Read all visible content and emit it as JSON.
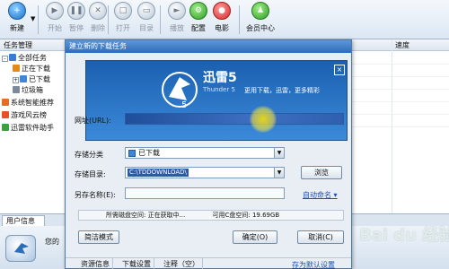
{
  "toolbar": {
    "buttons": [
      {
        "label": "新建",
        "icon": "new-icon",
        "color": "blue",
        "enabled": true
      },
      {
        "label": "开始",
        "icon": "play-icon",
        "color": "gray",
        "enabled": false
      },
      {
        "label": "暂停",
        "icon": "pause-icon",
        "color": "gray",
        "enabled": false
      },
      {
        "label": "删除",
        "icon": "delete-icon",
        "color": "gray",
        "enabled": false
      },
      {
        "label": "打开",
        "icon": "open-icon",
        "color": "gray",
        "enabled": false
      },
      {
        "label": "目录",
        "icon": "folder-icon",
        "color": "gray",
        "enabled": false
      },
      {
        "label": "播放",
        "icon": "play-media-icon",
        "color": "gray",
        "enabled": false
      },
      {
        "label": "配置",
        "icon": "config-icon",
        "color": "green",
        "enabled": true
      },
      {
        "label": "电影",
        "icon": "movie-icon",
        "color": "red",
        "enabled": true
      },
      {
        "label": "会员中心",
        "icon": "vip-icon",
        "color": "green",
        "enabled": true
      }
    ]
  },
  "left_panel": {
    "header": "任务管理",
    "tree": [
      {
        "label": "全部任务",
        "color": "#3a7bd5",
        "toggle": "-"
      },
      {
        "label": "正在下载",
        "color": "#e48a1a",
        "toggle": ""
      },
      {
        "label": "已下载",
        "color": "#3d86d8",
        "toggle": "+"
      },
      {
        "label": "垃圾箱",
        "color": "#7a8a9a",
        "toggle": ""
      },
      {
        "label": "系统智能推荐",
        "color": "#e86a2a",
        "toggle": ""
      },
      {
        "label": "游戏风云榜",
        "color": "#e8502a",
        "toggle": ""
      },
      {
        "label": "迅雷软件助手",
        "color": "#3aa040",
        "toggle": ""
      }
    ]
  },
  "list": {
    "columns": [
      "速度"
    ]
  },
  "user_info": {
    "tab": "用户信息",
    "text": "您的"
  },
  "dialog": {
    "title": "建立新的下载任务",
    "banner": {
      "title": "迅雷5",
      "subtitle": "Thunder 5",
      "slogan": "更用下载，迅雷，更多精彩",
      "close": "×"
    },
    "url_label": "网址(URL):",
    "url_value": "",
    "category_label": "存储分类",
    "category_value": "已下载",
    "dir_label": "存储目录:",
    "dir_value": "C:\\TDDOWNLOAD\\",
    "browse": "浏览",
    "saveas_label": "另存名称(E):",
    "saveas_value": "",
    "auto_name": "自动命名",
    "disk_info": "所需磁盘空间: 正在获取中...",
    "free_space": "可用C盘空间: 19.69GB",
    "simple_mode": "简洁模式",
    "ok": "确定(O)",
    "cancel": "取消(C)",
    "tabs": [
      "资源信息",
      "下载设置",
      "注释（空）"
    ],
    "save_default": "存为默认设置"
  },
  "watermark": "Bai du 经验",
  "colors": {
    "accent": "#2d6cb8",
    "title_bar": "#3f7fca",
    "highlight": "#ffe600"
  }
}
